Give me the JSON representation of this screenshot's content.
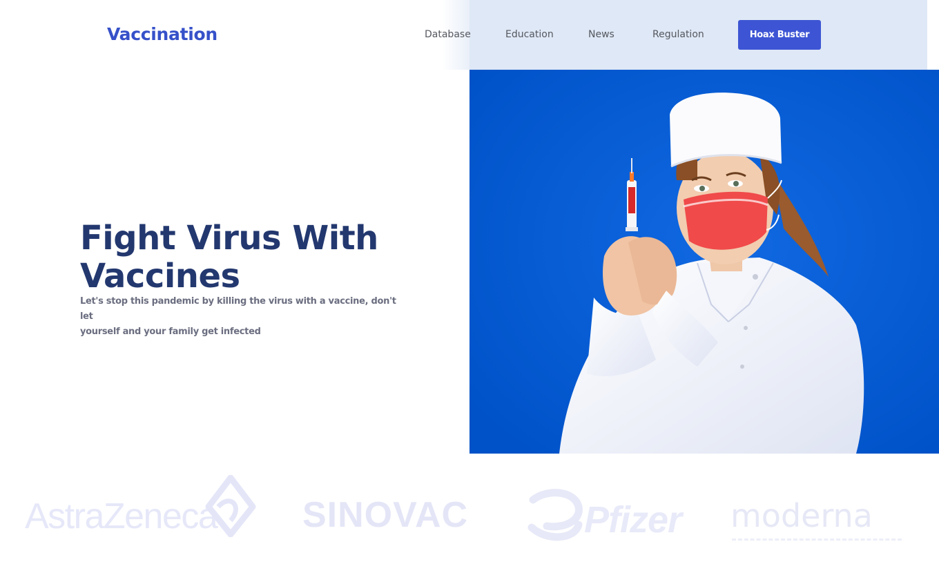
{
  "header": {
    "logo": "Vaccination",
    "nav": [
      "Database",
      "Education",
      "News",
      "Regulation"
    ],
    "cta": "Hoax Buster"
  },
  "hero": {
    "title_line1": "Fight Virus With",
    "title_line2": "Vaccines",
    "subtitle_line1": "Let's stop this pandemic by killing the virus with a vaccine, don't let",
    "subtitle_line2": "yourself and your family get infected",
    "image_icon": "nurse-with-syringe-photo"
  },
  "partners": [
    "AstraZeneca",
    "SINOVAC",
    "Pfizer",
    "moderna"
  ],
  "colors": {
    "brand": "#3651c9",
    "button": "#3d55d4",
    "title": "#23386f",
    "nav_bg": "#dfe8f6",
    "photo_bg": "#0057cf"
  }
}
